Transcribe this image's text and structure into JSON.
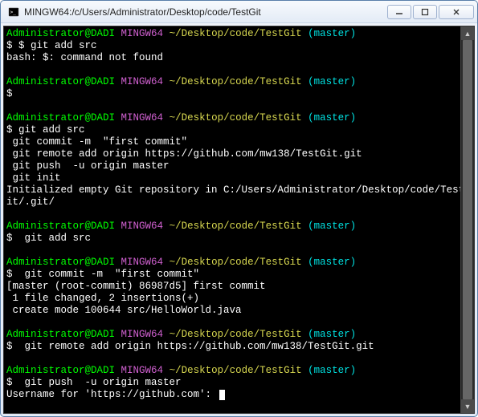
{
  "window": {
    "title": "MINGW64:/c/Users/Administrator/Desktop/code/TestGit"
  },
  "prompt": {
    "user": "Administrator@DADI",
    "host": "MINGW64",
    "path": "~/Desktop/code/TestGit",
    "branch": "(master)"
  },
  "blocks": [
    {
      "cmd": "$ $ git add src",
      "out": [
        "bash: $: command not found"
      ]
    },
    {
      "cmd": "$",
      "out": []
    },
    {
      "cmd": "$ git add src",
      "out": [
        " git commit -m  \"first commit\"",
        " git remote add origin https://github.com/mw138/TestGit.git",
        " git push  -u origin master",
        " git init",
        "Initialized empty Git repository in C:/Users/Administrator/Desktop/code/TestGit/.git/"
      ]
    },
    {
      "cmd": "$  git add src",
      "out": []
    },
    {
      "cmd": "$  git commit -m  \"first commit\"",
      "out": [
        "[master (root-commit) 86987d5] first commit",
        " 1 file changed, 2 insertions(+)",
        " create mode 100644 src/HelloWorld.java"
      ]
    },
    {
      "cmd": "$  git remote add origin https://github.com/mw138/TestGit.git",
      "out": []
    },
    {
      "cmd": "$  git push  -u origin master",
      "out": [
        "Username for 'https://github.com': "
      ],
      "cursor": true
    }
  ]
}
